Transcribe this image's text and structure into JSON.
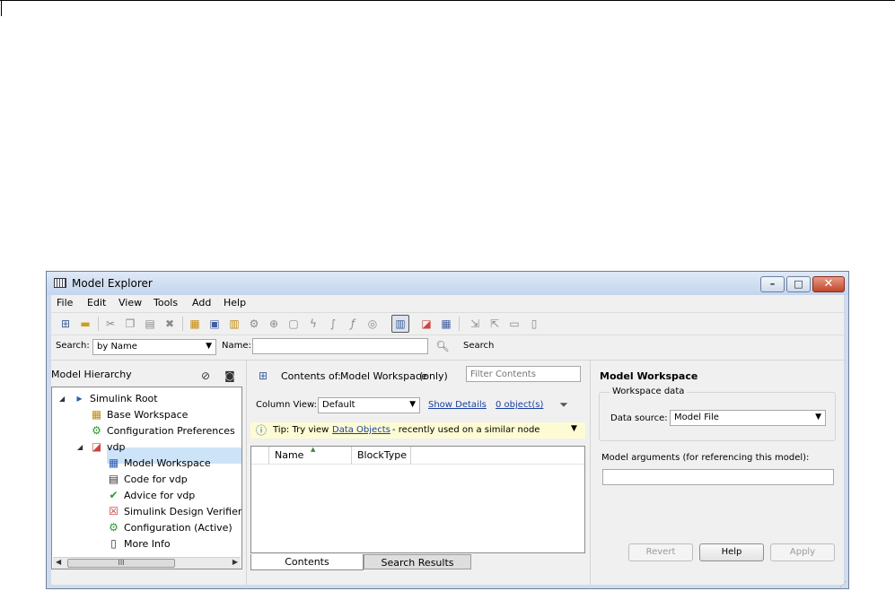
{
  "window": {
    "title": "Model Explorer",
    "controls": {
      "minimize": "–",
      "maximize": "□",
      "close": "✕"
    }
  },
  "menu": [
    "File",
    "Edit",
    "View",
    "Tools",
    "Add",
    "Help"
  ],
  "toolbar_icons": [
    "new-model-icon",
    "open-icon",
    "cut-icon",
    "copy-icon",
    "paste-icon",
    "delete-icon",
    "matrix-icon",
    "bus-icon",
    "tree-icon",
    "gear-icon",
    "zoom-icon",
    "binary-icon",
    "signal-icon",
    "fcn-icon",
    "fx-icon",
    "target-icon",
    "column-view-icon",
    "model-icon",
    "library-icon",
    "export-icon",
    "import-icon",
    "save-icon",
    "print-icon"
  ],
  "search": {
    "label": "Search:",
    "by": "by Name",
    "name_label": "Name:",
    "name_value": "",
    "button": "Search"
  },
  "hierarchy": {
    "title": "Model Hierarchy",
    "nodes": [
      {
        "label": "Simulink Root",
        "icon": "simulink-root-icon"
      },
      {
        "label": "Base Workspace",
        "icon": "workspace-grid-icon"
      },
      {
        "label": "Configuration Preferences",
        "icon": "config-gears-icon"
      },
      {
        "label": "vdp",
        "icon": "model-icon"
      },
      {
        "label": "Model Workspace",
        "icon": "model-workspace-icon",
        "selected": true
      },
      {
        "label": "Code for vdp",
        "icon": "code-icon"
      },
      {
        "label": "Advice for vdp",
        "icon": "advice-check-icon"
      },
      {
        "label": "Simulink Design Verifier re",
        "icon": "verifier-icon"
      },
      {
        "label": "Configuration (Active)",
        "icon": "config-gears-icon"
      },
      {
        "label": "More Info",
        "icon": "info-doc-icon"
      }
    ],
    "scroll_thumb": "III"
  },
  "contents": {
    "prefix": "Contents of:",
    "target": "Model Workspace",
    "suffix": "(only)",
    "filter_placeholder": "Filter Contents",
    "column_view_label": "Column View:",
    "column_view_value": "Default",
    "show_details": "Show Details",
    "object_count": "0 object(s)",
    "tip_prefix": "Tip: Try view",
    "tip_link": "Data Objects",
    "tip_suffix": "- recently used on a similar node",
    "columns": [
      "Name",
      "BlockType"
    ],
    "tabs": [
      "Contents",
      "Search Results"
    ]
  },
  "dialog": {
    "title": "Model Workspace",
    "group_title": "Workspace data",
    "data_source_label": "Data source:",
    "data_source_value": "Model File",
    "model_args_label": "Model arguments (for referencing this model):",
    "model_args_value": "",
    "buttons": {
      "revert": "Revert",
      "help": "Help",
      "apply": "Apply"
    }
  },
  "colors": {
    "accent": "#1a3fa0",
    "selection": "#cde3f7",
    "tip_bg": "#fdfbd3",
    "titlebar": "#c4d5ee"
  }
}
